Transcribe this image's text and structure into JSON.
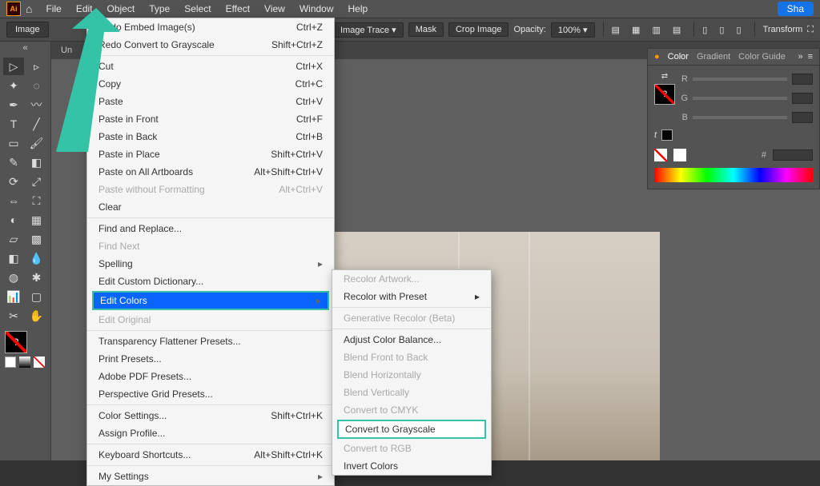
{
  "menubar": {
    "items": [
      "File",
      "Edit",
      "Object",
      "Type",
      "Select",
      "Effect",
      "View",
      "Window",
      "Help"
    ],
    "share": "Sha"
  },
  "controlbar": {
    "context_label": "Image",
    "image_trace": "Image Trace",
    "mask": "Mask",
    "crop": "Crop Image",
    "opacity_label": "Opacity:",
    "opacity_value": "100%",
    "transform": "Transform"
  },
  "doc": {
    "tab": "Un"
  },
  "edit_menu": {
    "rows": [
      {
        "l": "Undo Embed Image(s)",
        "s": "Ctrl+Z"
      },
      {
        "l": "Redo Convert to Grayscale",
        "s": "Shift+Ctrl+Z"
      },
      {
        "hr": true
      },
      {
        "l": "Cut",
        "s": "Ctrl+X"
      },
      {
        "l": "Copy",
        "s": "Ctrl+C"
      },
      {
        "l": "Paste",
        "s": "Ctrl+V"
      },
      {
        "l": "Paste in Front",
        "s": "Ctrl+F"
      },
      {
        "l": "Paste in Back",
        "s": "Ctrl+B"
      },
      {
        "l": "Paste in Place",
        "s": "Shift+Ctrl+V"
      },
      {
        "l": "Paste on All Artboards",
        "s": "Alt+Shift+Ctrl+V"
      },
      {
        "l": "Paste without Formatting",
        "s": "Alt+Ctrl+V",
        "disabled": true
      },
      {
        "l": "Clear"
      },
      {
        "hr": true
      },
      {
        "l": "Find and Replace..."
      },
      {
        "l": "Find Next",
        "disabled": true
      },
      {
        "l": "Spelling",
        "arrow": true
      },
      {
        "l": "Edit Custom Dictionary..."
      },
      {
        "l": "Edit Colors",
        "arrow": true,
        "selected": true
      },
      {
        "l": "Edit Original",
        "disabled": true
      },
      {
        "hr": true
      },
      {
        "l": "Transparency Flattener Presets..."
      },
      {
        "l": "Print Presets..."
      },
      {
        "l": "Adobe PDF Presets..."
      },
      {
        "l": "Perspective Grid Presets..."
      },
      {
        "hr": true
      },
      {
        "l": "Color Settings...",
        "s": "Shift+Ctrl+K"
      },
      {
        "l": "Assign Profile..."
      },
      {
        "hr": true
      },
      {
        "l": "Keyboard Shortcuts...",
        "s": "Alt+Shift+Ctrl+K"
      },
      {
        "hr": true
      },
      {
        "l": "My Settings",
        "arrow": true
      }
    ]
  },
  "submenu": {
    "rows": [
      {
        "l": "Recolor Artwork...",
        "disabled": true
      },
      {
        "l": "Recolor with Preset",
        "arrow": true
      },
      {
        "hr": true
      },
      {
        "l": "Generative Recolor (Beta)",
        "disabled": true
      },
      {
        "hr": true
      },
      {
        "l": "Adjust Color Balance..."
      },
      {
        "l": "Blend Front to Back",
        "disabled": true
      },
      {
        "l": "Blend Horizontally",
        "disabled": true
      },
      {
        "l": "Blend Vertically",
        "disabled": true
      },
      {
        "l": "Convert to CMYK",
        "disabled": true
      },
      {
        "l": "Convert to Grayscale",
        "highlight": true
      },
      {
        "l": "Convert to RGB",
        "disabled": true
      },
      {
        "l": "Invert Colors"
      }
    ]
  },
  "panel": {
    "tabs": [
      "Color",
      "Gradient",
      "Color Guide"
    ],
    "channels": [
      "R",
      "G",
      "B"
    ],
    "t_italic": "t",
    "hash": "#",
    "question": "?"
  }
}
